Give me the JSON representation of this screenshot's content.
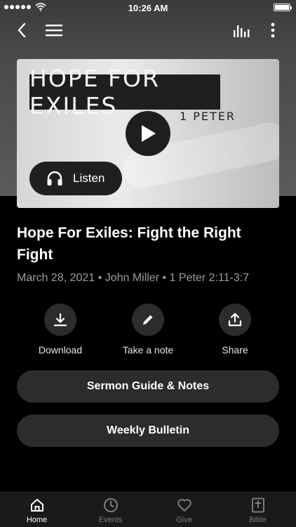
{
  "status_bar": {
    "time": "10:26 AM"
  },
  "artwork": {
    "series_title": "HOPE FOR EXILES",
    "series_subtitle": "1 PETER"
  },
  "listen_button": {
    "label": "Listen"
  },
  "sermon": {
    "title": "Hope For Exiles: Fight the Right Fight",
    "meta": "March 28, 2021 • John Miller • 1 Peter 2:11-3:7"
  },
  "actions": [
    {
      "label": "Download",
      "icon": "download-icon"
    },
    {
      "label": "Take a note",
      "icon": "pencil-icon"
    },
    {
      "label": "Share",
      "icon": "share-icon"
    }
  ],
  "buttons": {
    "sermon_guide": "Sermon Guide & Notes",
    "bulletin": "Weekly Bulletin"
  },
  "tabs": [
    {
      "label": "Home",
      "icon": "home-icon",
      "active": true
    },
    {
      "label": "Events",
      "icon": "clock-icon",
      "active": false
    },
    {
      "label": "Give",
      "icon": "heart-icon",
      "active": false
    },
    {
      "label": "Bible",
      "icon": "bible-icon",
      "active": false
    }
  ],
  "colors": {
    "background": "#000000",
    "surface": "#2c2c2c",
    "muted_text": "#9c9c9c",
    "tab_inactive": "#7d7d7d"
  }
}
